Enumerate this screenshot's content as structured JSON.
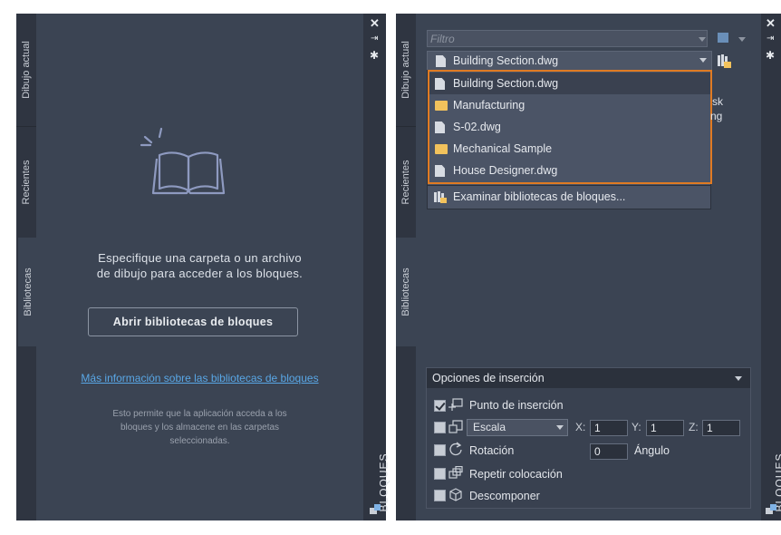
{
  "left_palette": {
    "tabs": {
      "current": "Dibujo actual",
      "recent": "Recientes",
      "libraries": "Bibliotecas"
    },
    "side_title": "BLOQUES",
    "hint_line1": "Especifique una carpeta o un archivo",
    "hint_line2": "de dibujo para acceder a los bloques.",
    "open_button": "Abrir bibliotecas de bloques",
    "more_link": "Más información sobre las bibliotecas de bloques",
    "note_line1": "Esto permite que la aplicación acceda a los",
    "note_line2": "bloques y los almacene en las carpetas",
    "note_line3": "seleccionadas."
  },
  "right_palette": {
    "tabs": {
      "current": "Dibujo actual",
      "recent": "Recientes",
      "libraries": "Bibliotecas"
    },
    "side_title": "BLOQUES",
    "filter_placeholder": "Filtro",
    "library_selected": "Building Section.dwg",
    "dropdown_items": [
      {
        "label": "Building Section.dwg",
        "icon": "file-icon"
      },
      {
        "label": "Manufacturing",
        "icon": "folder-icon"
      },
      {
        "label": "S-02.dwg",
        "icon": "file-icon"
      },
      {
        "label": "Mechanical Sample",
        "icon": "folder-icon"
      },
      {
        "label": "House Designer.dwg",
        "icon": "file-icon"
      }
    ],
    "browse_label": "Examinar bibliotecas de bloques...",
    "peek_text_1": "sk",
    "peek_text_2": "ng",
    "options": {
      "header": "Opciones de inserción",
      "insertion_point": "Punto de inserción",
      "insertion_point_checked": true,
      "scale_mode": "Escala",
      "x_label": "X:",
      "x_value": "1",
      "y_label": "Y:",
      "y_value": "1",
      "z_label": "Z:",
      "z_value": "1",
      "rotation": "Rotación",
      "angle_value": "0",
      "angle_label": "Ángulo",
      "repeat": "Repetir colocación",
      "explode": "Descomponer"
    }
  },
  "colors": {
    "panel": "#3b4453",
    "tabstrip": "#2f3541",
    "highlight": "#e07b23",
    "link": "#59a7e6",
    "folder": "#f2c25c"
  }
}
